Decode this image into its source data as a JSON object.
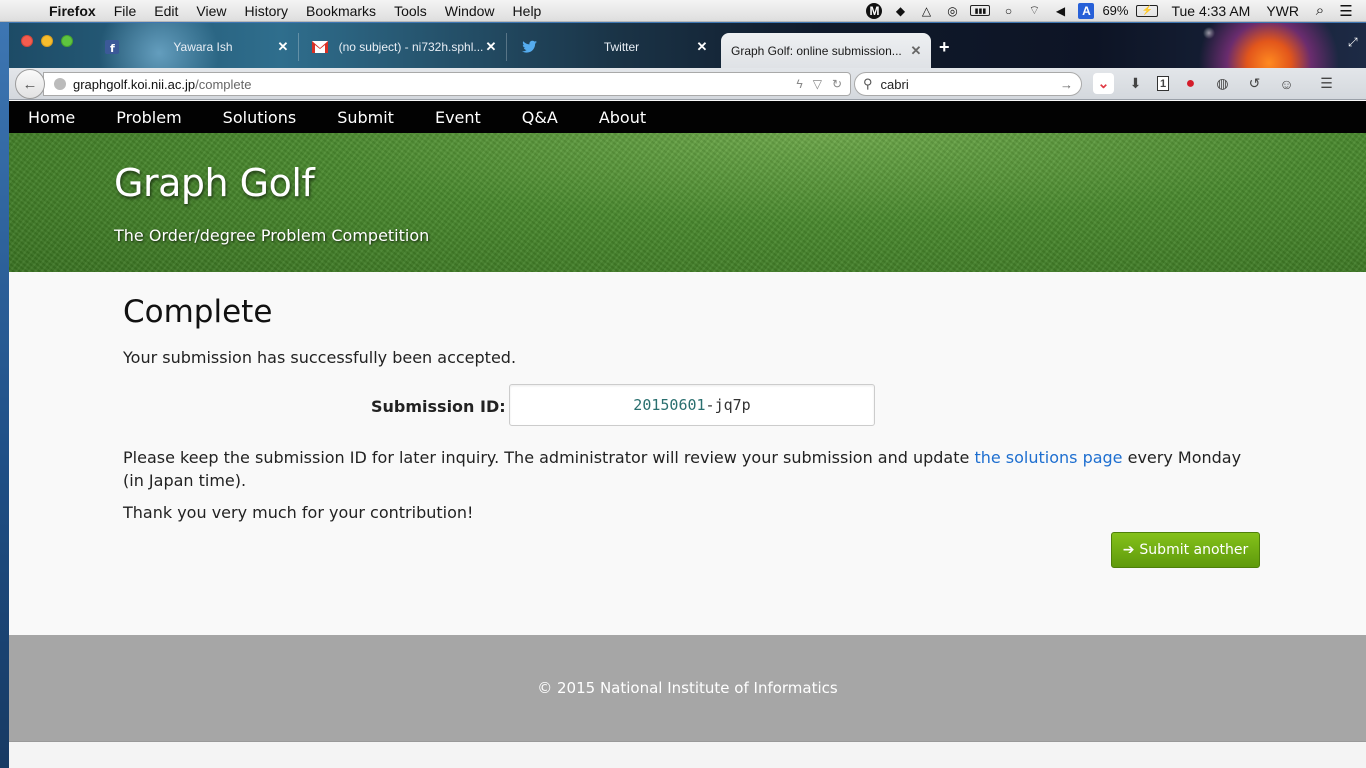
{
  "menubar": {
    "app_name": "Firefox",
    "items": [
      "File",
      "Edit",
      "View",
      "History",
      "Bookmarks",
      "Tools",
      "Window",
      "Help"
    ],
    "battery": "69%",
    "clock": "Tue 4:33 AM",
    "user": "YWR",
    "input_source": "A"
  },
  "tabs": [
    {
      "title": "Yawara Ish",
      "icon": "facebook-icon"
    },
    {
      "title": "(no subject) - ni732h.sphl...",
      "icon": "gmail-icon"
    },
    {
      "title": "Twitter",
      "icon": "twitter-icon"
    },
    {
      "title": "Graph Golf: online submission...",
      "icon": "none"
    }
  ],
  "navbar": {
    "url_host": "graphgolf.koi.nii.ac.jp",
    "url_path": "/complete",
    "search_value": "cabri"
  },
  "site_nav": [
    "Home",
    "Problem",
    "Solutions",
    "Submit",
    "Event",
    "Q&A",
    "About"
  ],
  "hero": {
    "title": "Graph Golf",
    "subtitle": "The Order/degree Problem Competition"
  },
  "content": {
    "heading": "Complete",
    "accepted_text": "Your submission has successfully been accepted.",
    "sid_label": "Submission ID:",
    "sid_date": "20150601",
    "sid_sep": "-",
    "sid_code": "jq7p",
    "keep_text_before": "Please keep the submission ID for later inquiry. The administrator will review your submission and update ",
    "keep_link": "the solutions page",
    "keep_text_after": " every Monday (in Japan time).",
    "thanks": "Thank you very much for your contribution!",
    "submit_another": "Submit another"
  },
  "footer": {
    "copyright": "© 2015 National Institute of Informatics"
  },
  "colors": {
    "accent_green": "#6fae14",
    "link_blue": "#1e6fd0",
    "nav_black": "#020202",
    "footer_gray": "#a6a6a6"
  }
}
